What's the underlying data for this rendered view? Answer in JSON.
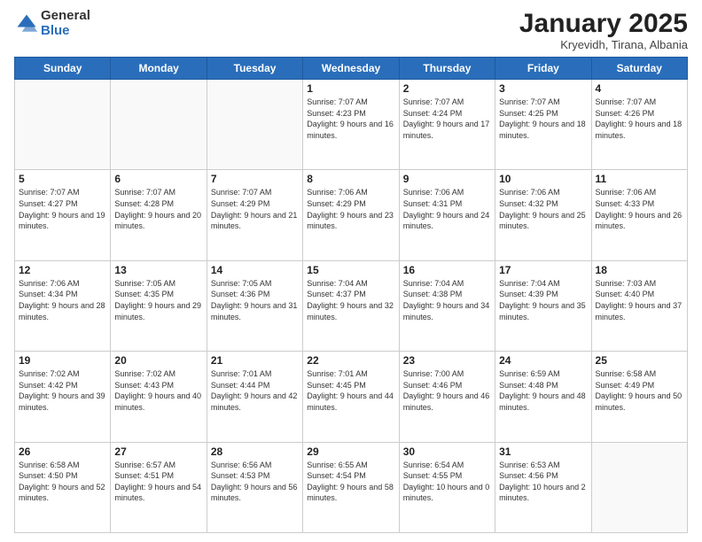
{
  "logo": {
    "general": "General",
    "blue": "Blue"
  },
  "header": {
    "month": "January 2025",
    "location": "Kryevidh, Tirana, Albania"
  },
  "weekdays": [
    "Sunday",
    "Monday",
    "Tuesday",
    "Wednesday",
    "Thursday",
    "Friday",
    "Saturday"
  ],
  "weeks": [
    [
      {
        "day": "",
        "info": ""
      },
      {
        "day": "",
        "info": ""
      },
      {
        "day": "",
        "info": ""
      },
      {
        "day": "1",
        "sunrise": "7:07 AM",
        "sunset": "4:23 PM",
        "daylight": "9 hours and 16 minutes."
      },
      {
        "day": "2",
        "sunrise": "7:07 AM",
        "sunset": "4:24 PM",
        "daylight": "9 hours and 17 minutes."
      },
      {
        "day": "3",
        "sunrise": "7:07 AM",
        "sunset": "4:25 PM",
        "daylight": "9 hours and 18 minutes."
      },
      {
        "day": "4",
        "sunrise": "7:07 AM",
        "sunset": "4:26 PM",
        "daylight": "9 hours and 18 minutes."
      }
    ],
    [
      {
        "day": "5",
        "sunrise": "7:07 AM",
        "sunset": "4:27 PM",
        "daylight": "9 hours and 19 minutes."
      },
      {
        "day": "6",
        "sunrise": "7:07 AM",
        "sunset": "4:28 PM",
        "daylight": "9 hours and 20 minutes."
      },
      {
        "day": "7",
        "sunrise": "7:07 AM",
        "sunset": "4:29 PM",
        "daylight": "9 hours and 21 minutes."
      },
      {
        "day": "8",
        "sunrise": "7:06 AM",
        "sunset": "4:29 PM",
        "daylight": "9 hours and 23 minutes."
      },
      {
        "day": "9",
        "sunrise": "7:06 AM",
        "sunset": "4:31 PM",
        "daylight": "9 hours and 24 minutes."
      },
      {
        "day": "10",
        "sunrise": "7:06 AM",
        "sunset": "4:32 PM",
        "daylight": "9 hours and 25 minutes."
      },
      {
        "day": "11",
        "sunrise": "7:06 AM",
        "sunset": "4:33 PM",
        "daylight": "9 hours and 26 minutes."
      }
    ],
    [
      {
        "day": "12",
        "sunrise": "7:06 AM",
        "sunset": "4:34 PM",
        "daylight": "9 hours and 28 minutes."
      },
      {
        "day": "13",
        "sunrise": "7:05 AM",
        "sunset": "4:35 PM",
        "daylight": "9 hours and 29 minutes."
      },
      {
        "day": "14",
        "sunrise": "7:05 AM",
        "sunset": "4:36 PM",
        "daylight": "9 hours and 31 minutes."
      },
      {
        "day": "15",
        "sunrise": "7:04 AM",
        "sunset": "4:37 PM",
        "daylight": "9 hours and 32 minutes."
      },
      {
        "day": "16",
        "sunrise": "7:04 AM",
        "sunset": "4:38 PM",
        "daylight": "9 hours and 34 minutes."
      },
      {
        "day": "17",
        "sunrise": "7:04 AM",
        "sunset": "4:39 PM",
        "daylight": "9 hours and 35 minutes."
      },
      {
        "day": "18",
        "sunrise": "7:03 AM",
        "sunset": "4:40 PM",
        "daylight": "9 hours and 37 minutes."
      }
    ],
    [
      {
        "day": "19",
        "sunrise": "7:02 AM",
        "sunset": "4:42 PM",
        "daylight": "9 hours and 39 minutes."
      },
      {
        "day": "20",
        "sunrise": "7:02 AM",
        "sunset": "4:43 PM",
        "daylight": "9 hours and 40 minutes."
      },
      {
        "day": "21",
        "sunrise": "7:01 AM",
        "sunset": "4:44 PM",
        "daylight": "9 hours and 42 minutes."
      },
      {
        "day": "22",
        "sunrise": "7:01 AM",
        "sunset": "4:45 PM",
        "daylight": "9 hours and 44 minutes."
      },
      {
        "day": "23",
        "sunrise": "7:00 AM",
        "sunset": "4:46 PM",
        "daylight": "9 hours and 46 minutes."
      },
      {
        "day": "24",
        "sunrise": "6:59 AM",
        "sunset": "4:48 PM",
        "daylight": "9 hours and 48 minutes."
      },
      {
        "day": "25",
        "sunrise": "6:58 AM",
        "sunset": "4:49 PM",
        "daylight": "9 hours and 50 minutes."
      }
    ],
    [
      {
        "day": "26",
        "sunrise": "6:58 AM",
        "sunset": "4:50 PM",
        "daylight": "9 hours and 52 minutes."
      },
      {
        "day": "27",
        "sunrise": "6:57 AM",
        "sunset": "4:51 PM",
        "daylight": "9 hours and 54 minutes."
      },
      {
        "day": "28",
        "sunrise": "6:56 AM",
        "sunset": "4:53 PM",
        "daylight": "9 hours and 56 minutes."
      },
      {
        "day": "29",
        "sunrise": "6:55 AM",
        "sunset": "4:54 PM",
        "daylight": "9 hours and 58 minutes."
      },
      {
        "day": "30",
        "sunrise": "6:54 AM",
        "sunset": "4:55 PM",
        "daylight": "10 hours and 0 minutes."
      },
      {
        "day": "31",
        "sunrise": "6:53 AM",
        "sunset": "4:56 PM",
        "daylight": "10 hours and 2 minutes."
      },
      {
        "day": "",
        "info": ""
      }
    ]
  ]
}
